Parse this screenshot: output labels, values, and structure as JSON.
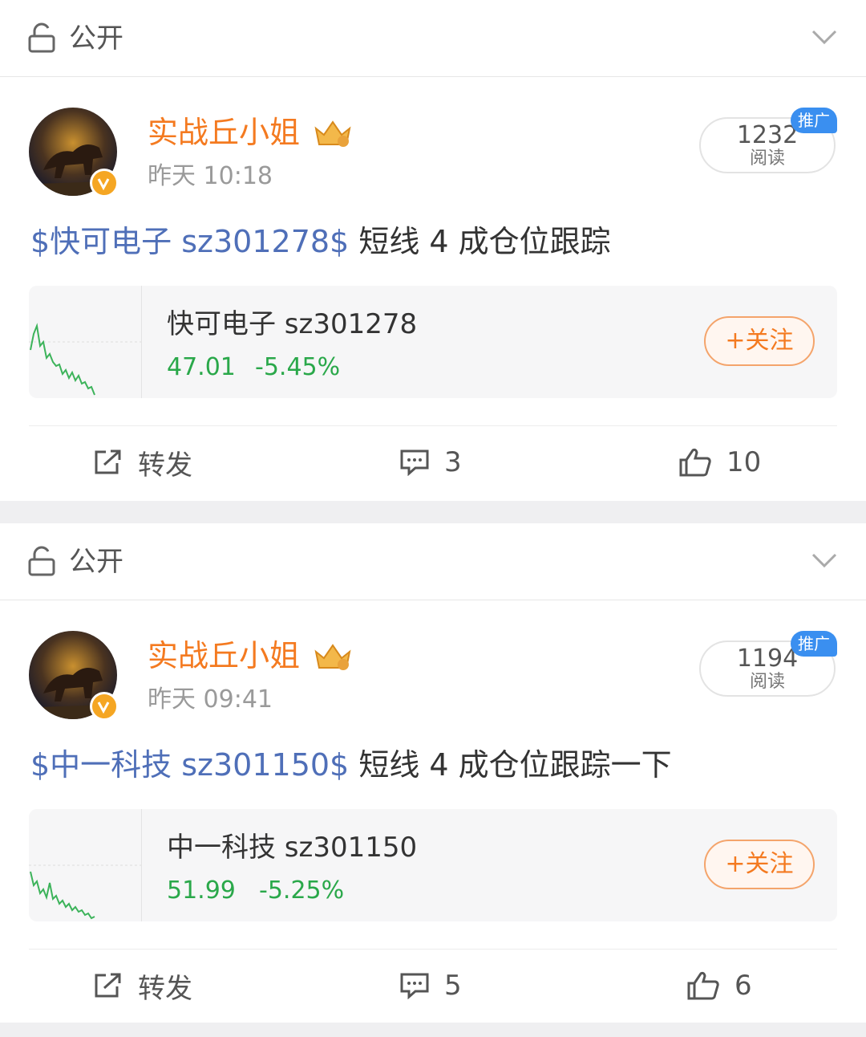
{
  "posts": [
    {
      "visibility": "公开",
      "author": "实战丘小姐",
      "time": "昨天 10:18",
      "reads": "1232",
      "reads_label": "阅读",
      "promo": "推广",
      "content_tag": "$快可电子 sz301278$",
      "content_text": " 短线 4 成仓位跟踪",
      "stock": {
        "name": "快可电子 sz301278",
        "price": "47.01",
        "change": "-5.45%",
        "follow": "+关注"
      },
      "actions": {
        "repost": "转发",
        "comments": "3",
        "likes": "10"
      }
    },
    {
      "visibility": "公开",
      "author": "实战丘小姐",
      "time": "昨天 09:41",
      "reads": "1194",
      "reads_label": "阅读",
      "promo": "推广",
      "content_tag": "$中一科技 sz301150$",
      "content_text": " 短线 4 成仓位跟踪一下",
      "stock": {
        "name": "中一科技 sz301150",
        "price": "51.99",
        "change": "-5.25%",
        "follow": "+关注"
      },
      "actions": {
        "repost": "转发",
        "comments": "5",
        "likes": "6"
      }
    }
  ],
  "colors": {
    "author": "#f47a20",
    "tag": "#4f6fb8",
    "down": "#2aa84a",
    "promo": "#3a8ff0"
  },
  "icons": [
    "lock-icon",
    "chevron-down-icon",
    "verified-icon",
    "crown-badge-icon",
    "repost-icon",
    "comment-icon",
    "like-icon"
  ]
}
